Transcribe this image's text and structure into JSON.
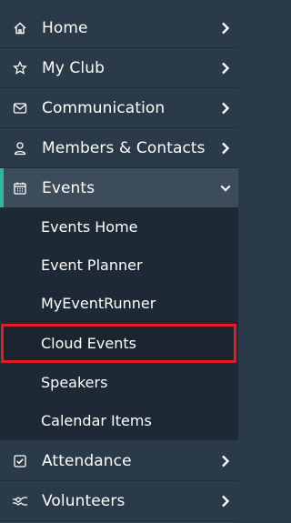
{
  "nav": {
    "items": [
      {
        "label": "Home",
        "icon": "home-icon"
      },
      {
        "label": "My Club",
        "icon": "star-icon"
      },
      {
        "label": "Communication",
        "icon": "mail-icon"
      },
      {
        "label": "Members & Contacts",
        "icon": "person-icon"
      },
      {
        "label": "Events",
        "icon": "calendar-icon",
        "expanded": true
      },
      {
        "label": "Attendance",
        "icon": "checkbox-icon"
      },
      {
        "label": "Volunteers",
        "icon": "handshake-icon"
      }
    ],
    "events_submenu": [
      {
        "label": "Events Home"
      },
      {
        "label": "Event Planner"
      },
      {
        "label": "MyEventRunner"
      },
      {
        "label": "Cloud Events",
        "highlighted": true
      },
      {
        "label": "Speakers"
      },
      {
        "label": "Calendar Items"
      }
    ]
  },
  "colors": {
    "background": "#2a3a48",
    "submenu_background": "#1d2935",
    "active_background": "#3c4c5a",
    "accent": "#2fb7a0",
    "highlight_border": "#e31b23"
  }
}
